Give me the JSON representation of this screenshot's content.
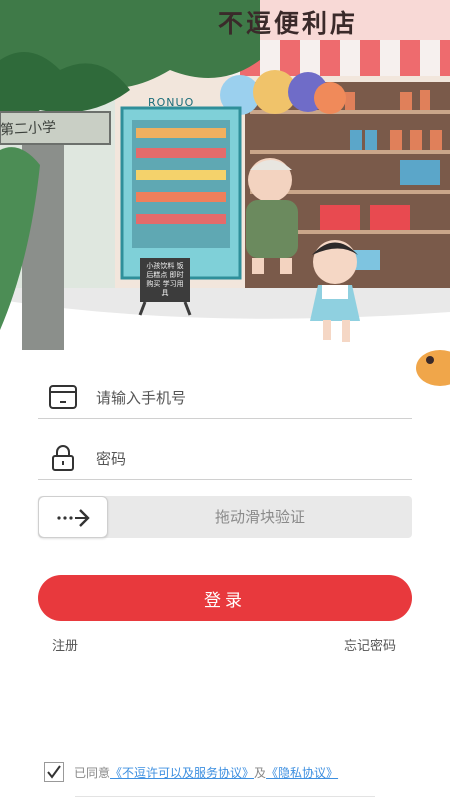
{
  "illustration": {
    "shop_sign": "不逗便利店",
    "school_sign": "第二小学",
    "brand_sign": "RONUO",
    "board_text": "小孩饮料 饭后糕点 即时购买 学习用具"
  },
  "form": {
    "phone": {
      "placeholder": "请输入手机号",
      "value": ""
    },
    "password": {
      "placeholder": "密码",
      "value": ""
    },
    "slider_hint": "拖动滑块验证",
    "login_label": "登录",
    "register_label": "注册",
    "forgot_label": "忘记密码"
  },
  "agreement": {
    "checked": true,
    "prefix": "已同意",
    "service_link": "《不逗许可以及服务协议》",
    "conjunction": "及",
    "privacy_link": "《隐私协议》"
  },
  "icons": {
    "phone": "phone-frame-icon",
    "password": "lock-icon",
    "slider": "arrow-right-icon",
    "checkbox": "checkmark-icon"
  },
  "colors": {
    "primary": "#e8393d",
    "link": "#3d8fe0",
    "awning_red": "#ee6b6e",
    "sky": "#dfe7df",
    "tree": "#3f7a48"
  }
}
